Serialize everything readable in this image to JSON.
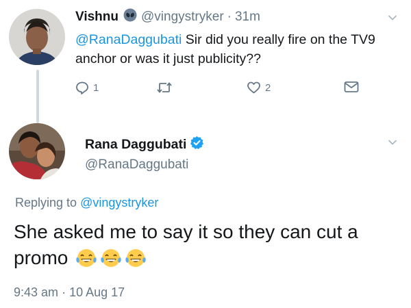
{
  "reply_tweet": {
    "author_name": "Vishnu",
    "author_handle": "@vingystryker",
    "separator": "·",
    "time": "31m",
    "text_mention": "@RanaDaggubati",
    "text_body": " Sir did you really fire on the TV9 anchor or was it just publicity??",
    "actions": {
      "reply_count": "1",
      "retweet_count": "",
      "like_count": "2"
    },
    "icons": {
      "badge": "alien-badge-icon",
      "reply": "reply-icon",
      "retweet": "retweet-icon",
      "like": "heart-icon",
      "message": "envelope-icon",
      "menu": "chevron-down-icon"
    }
  },
  "main_tweet": {
    "author_name": "Rana Daggubati",
    "author_handle": "@RanaDaggubati",
    "replying_label": "Replying to ",
    "replying_handle": "@vingystryker",
    "text": "She asked me to say it so they can cut a promo",
    "emojis": [
      "face-with-tears-of-joy",
      "face-with-tears-of-joy",
      "face-with-tears-of-joy"
    ],
    "timestamp": "9:43 am",
    "separator": "·",
    "date": "10 Aug 17",
    "icons": {
      "verified": "verified-badge-icon",
      "menu": "chevron-down-icon"
    }
  },
  "colors": {
    "link": "#1b95e0",
    "secondary_text": "#657786",
    "verified": "#1da1f2",
    "emoji_face": "#ffcc4d"
  }
}
